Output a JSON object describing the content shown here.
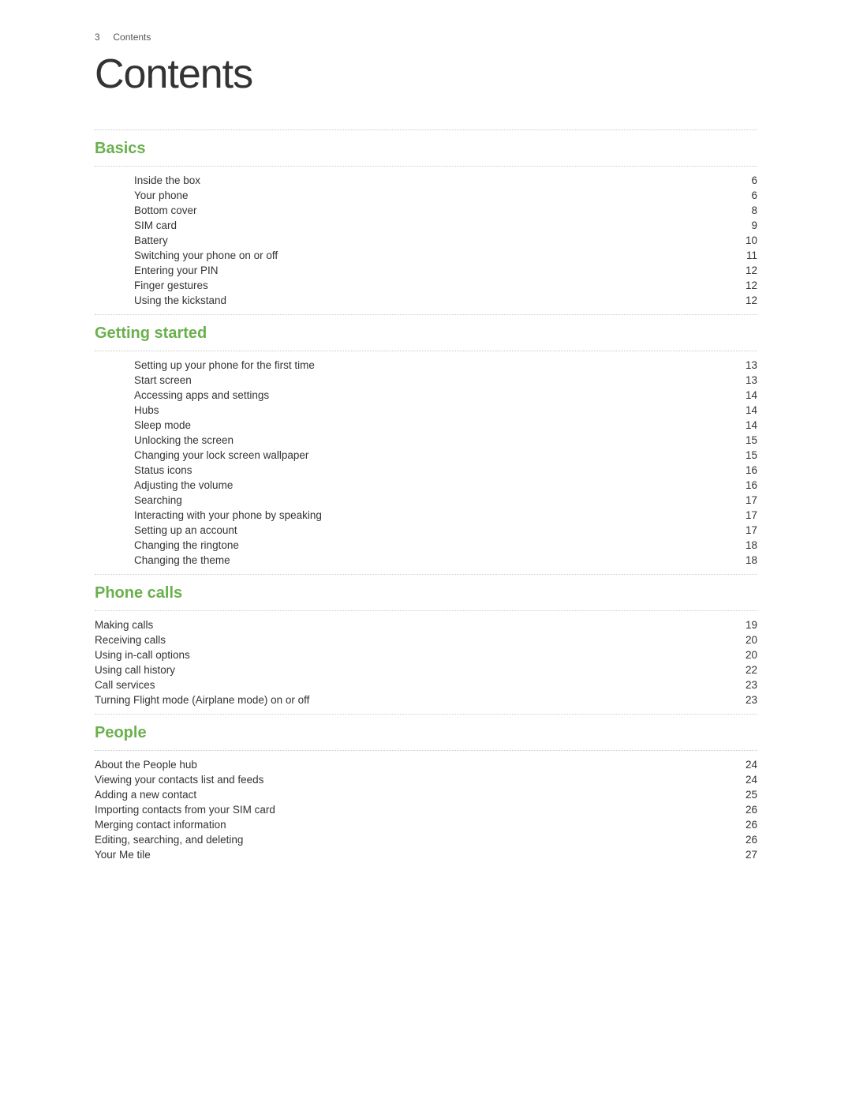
{
  "page": {
    "page_num": "3",
    "page_num_label": "Contents",
    "title": "Contents"
  },
  "sections": [
    {
      "id": "basics",
      "title": "Basics",
      "indented": true,
      "entries": [
        {
          "label": "Inside the box",
          "page": "6"
        },
        {
          "label": "Your phone",
          "page": "6"
        },
        {
          "label": "Bottom cover",
          "page": "8"
        },
        {
          "label": "SIM card",
          "page": "9"
        },
        {
          "label": "Battery",
          "page": "10"
        },
        {
          "label": "Switching your phone on or off",
          "page": "11"
        },
        {
          "label": "Entering your PIN",
          "page": "12"
        },
        {
          "label": "Finger gestures",
          "page": "12"
        },
        {
          "label": "Using the kickstand",
          "page": "12"
        }
      ]
    },
    {
      "id": "getting-started",
      "title": "Getting started",
      "indented": true,
      "entries": [
        {
          "label": "Setting up your phone for the first time",
          "page": "13"
        },
        {
          "label": "Start screen",
          "page": "13"
        },
        {
          "label": "Accessing apps and settings",
          "page": "14"
        },
        {
          "label": "Hubs",
          "page": "14"
        },
        {
          "label": "Sleep mode",
          "page": "14"
        },
        {
          "label": "Unlocking the screen",
          "page": "15"
        },
        {
          "label": "Changing your lock screen wallpaper",
          "page": "15"
        },
        {
          "label": "Status icons",
          "page": "16"
        },
        {
          "label": "Adjusting the volume",
          "page": "16"
        },
        {
          "label": "Searching",
          "page": "17"
        },
        {
          "label": "Interacting with your phone by speaking",
          "page": "17"
        },
        {
          "label": "Setting up an account",
          "page": "17"
        },
        {
          "label": "Changing the ringtone",
          "page": "18"
        },
        {
          "label": "Changing the theme",
          "page": "18"
        }
      ]
    },
    {
      "id": "phone-calls",
      "title": "Phone calls",
      "indented": false,
      "entries": [
        {
          "label": "Making calls",
          "page": "19"
        },
        {
          "label": "Receiving calls",
          "page": "20"
        },
        {
          "label": "Using in-call options",
          "page": "20"
        },
        {
          "label": "Using call history",
          "page": "22"
        },
        {
          "label": "Call services",
          "page": "23"
        },
        {
          "label": "Turning Flight mode (Airplane mode) on or off",
          "page": "23"
        }
      ]
    },
    {
      "id": "people",
      "title": "People",
      "indented": false,
      "entries": [
        {
          "label": "About the People hub",
          "page": "24"
        },
        {
          "label": "Viewing your contacts list and feeds",
          "page": "24"
        },
        {
          "label": "Adding a new contact",
          "page": "25"
        },
        {
          "label": "Importing contacts from your SIM card",
          "page": "26"
        },
        {
          "label": "Merging contact information",
          "page": "26"
        },
        {
          "label": "Editing, searching, and deleting",
          "page": "26"
        },
        {
          "label": "Your Me tile",
          "page": "27"
        }
      ]
    }
  ]
}
